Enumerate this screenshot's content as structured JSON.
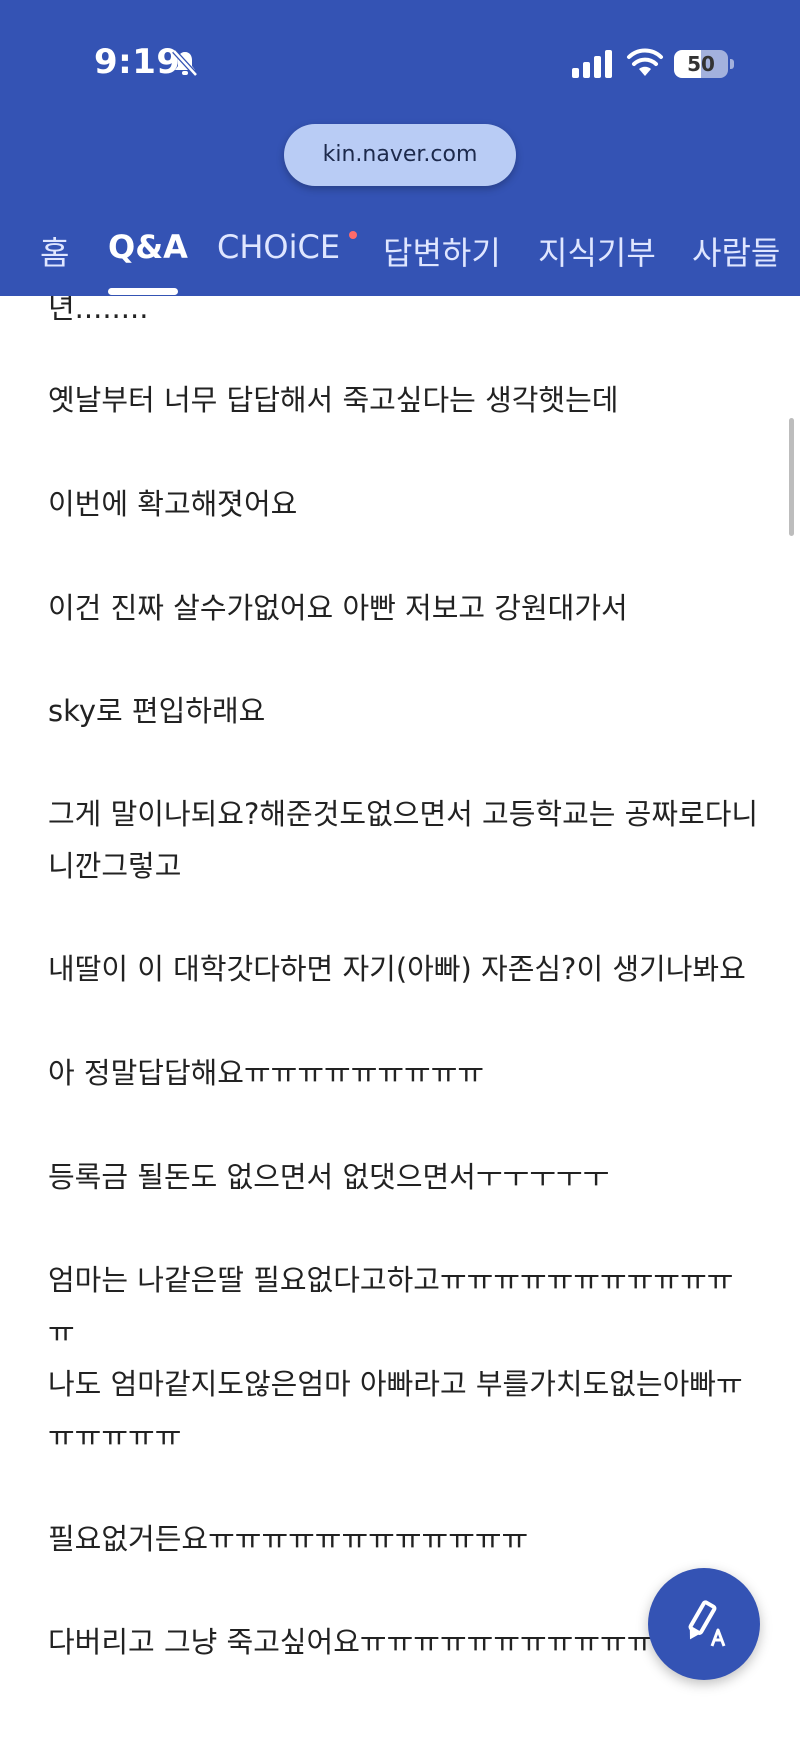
{
  "status_bar": {
    "time": "9:19",
    "battery_level": "50",
    "icons": [
      "bell-muted-icon",
      "cellular-signal-icon",
      "wifi-icon",
      "battery-icon"
    ]
  },
  "browser": {
    "url": "kin.naver.com"
  },
  "tabs": [
    {
      "label": "홈",
      "active": false
    },
    {
      "label": "Q&A",
      "active": true
    },
    {
      "label": "CHOiCE",
      "active": false,
      "has_new_dot": true
    },
    {
      "label": "답변하기",
      "active": false
    },
    {
      "label": "지식기부",
      "active": false
    },
    {
      "label": "사람들",
      "active": false
    }
  ],
  "post": {
    "paragraphs": [
      "년........",
      "옛날부터 너무 답답해서 죽고싶다는 생각햇는데",
      "이번에 확고해졋어요",
      "이건 진짜 살수가없어요 아빤 저보고 강원대가서",
      "sky로 편입하래요",
      "그게 말이나되요?해준것도없으면서 고등학교는 공짜로다니니깐그렇고",
      "내딸이 이 대학갓다하면 자기(아빠) 자존심?이 생기나봐요",
      "아 정말답답해요ㅠㅠㅠㅠㅠㅠㅠㅠㅠ",
      "등록금 될돈도 없으면서 없댓으면서ㅜㅜㅜㅜㅜ",
      "엄마는 나같은딸 필요없다고하고ㅠㅠㅠㅠㅠㅠㅠㅠㅠㅠㅠㅠ",
      "나도 엄마같지도않은엄마 아빠라고 부를가치도없는아빠ㅠㅠㅠㅠㅠㅠ",
      "필요없거든요ㅠㅠㅠㅠㅠㅠㅠㅠㅠㅠㅠㅠ",
      "다버리고 그냥 죽고싶어요ㅠㅠㅠㅠㅠㅠㅠㅠㅠㅠㅠ"
    ]
  },
  "fab": {
    "icon": "write-answer-icon"
  },
  "colors": {
    "header_bg": "#3453b4",
    "url_pill_bg": "#b9ccf5",
    "body_text": "#222222",
    "new_dot": "#ff6b6b"
  }
}
